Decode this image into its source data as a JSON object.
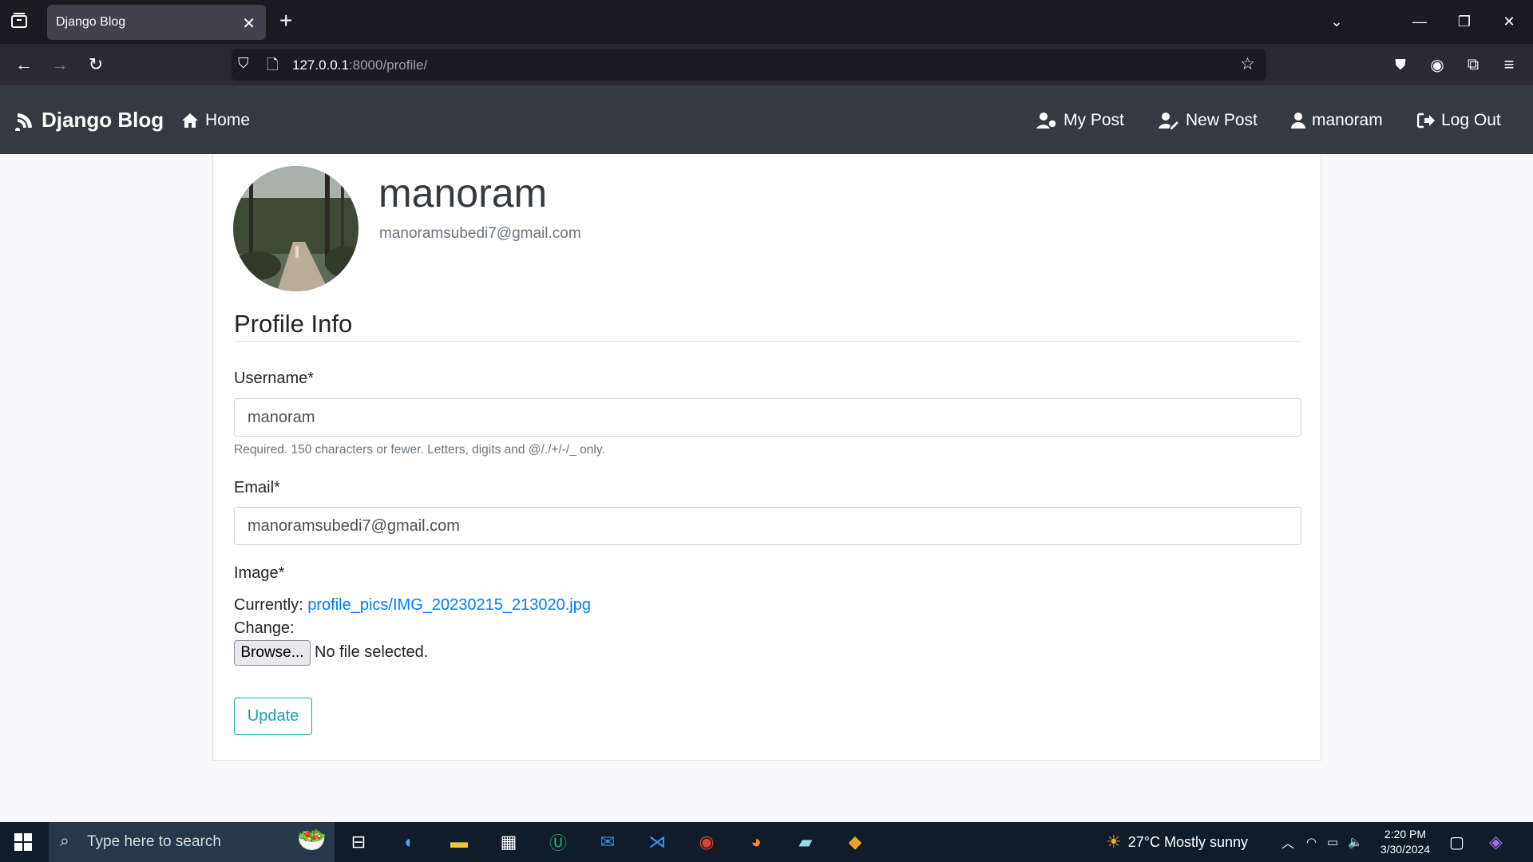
{
  "browser": {
    "tab_title": "Django Blog",
    "url_host": "127.0.0.1",
    "url_rest": ":8000/profile/"
  },
  "site": {
    "brand": "Django Blog",
    "nav": {
      "home": "Home",
      "my_post": "My Post",
      "new_post": "New Post",
      "user": "manoram",
      "logout": "Log Out"
    }
  },
  "profile": {
    "username": "manoram",
    "email": "manoramsubedi7@gmail.com"
  },
  "form": {
    "legend": "Profile Info",
    "username_label": "Username*",
    "username_value": "manoram",
    "username_help": "Required. 150 characters or fewer. Letters, digits and @/./+/-/_ only.",
    "email_label": "Email*",
    "email_value": "manoramsubedi7@gmail.com",
    "image_label": "Image*",
    "currently_label": "Currently:",
    "current_file": "profile_pics/IMG_20230215_213020.jpg",
    "change_label": "Change:",
    "browse_label": "Browse...",
    "no_file": "No file selected.",
    "submit": "Update"
  },
  "taskbar": {
    "search_placeholder": "Type here to search",
    "weather": "27°C  Mostly sunny",
    "time": "2:20 PM",
    "date": "3/30/2024"
  },
  "colors": {
    "navbar": "#343a40",
    "link": "#007bff",
    "update_button": "#17a2b8"
  }
}
